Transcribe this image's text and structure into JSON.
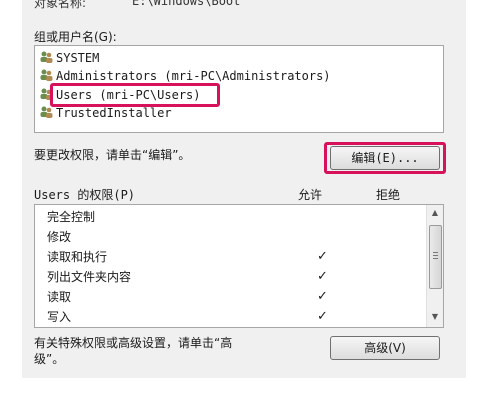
{
  "object": {
    "label": "对象名称:",
    "value": "E:\\Windows\\Boot"
  },
  "group_label": "组或用户名(G):",
  "users": [
    {
      "name": "SYSTEM"
    },
    {
      "name": "Administrators (mri-PC\\Administrators)"
    },
    {
      "name": "Users (mri-PC\\Users)"
    },
    {
      "name": "TrustedInstaller"
    }
  ],
  "edit_hint": "要更改权限，请单击“编辑”。",
  "edit_button": "编辑(E)...",
  "permissions": {
    "title": "Users 的权限(P)",
    "allow_header": "允许",
    "deny_header": "拒绝",
    "rows": [
      {
        "name": "完全控制",
        "allow": ""
      },
      {
        "name": "修改",
        "allow": ""
      },
      {
        "name": "读取和执行",
        "allow": "✓"
      },
      {
        "name": "列出文件夹内容",
        "allow": "✓"
      },
      {
        "name": "读取",
        "allow": "✓"
      },
      {
        "name": "写入",
        "allow": "✓"
      }
    ]
  },
  "advanced_hint_line1": "有关特殊权限或高级设置，请单击“高",
  "advanced_hint_line2": "级”。",
  "advanced_button": "高级(V)",
  "colors": {
    "highlight": "#d8125a",
    "dialog_bg": "#f0f0f0"
  }
}
